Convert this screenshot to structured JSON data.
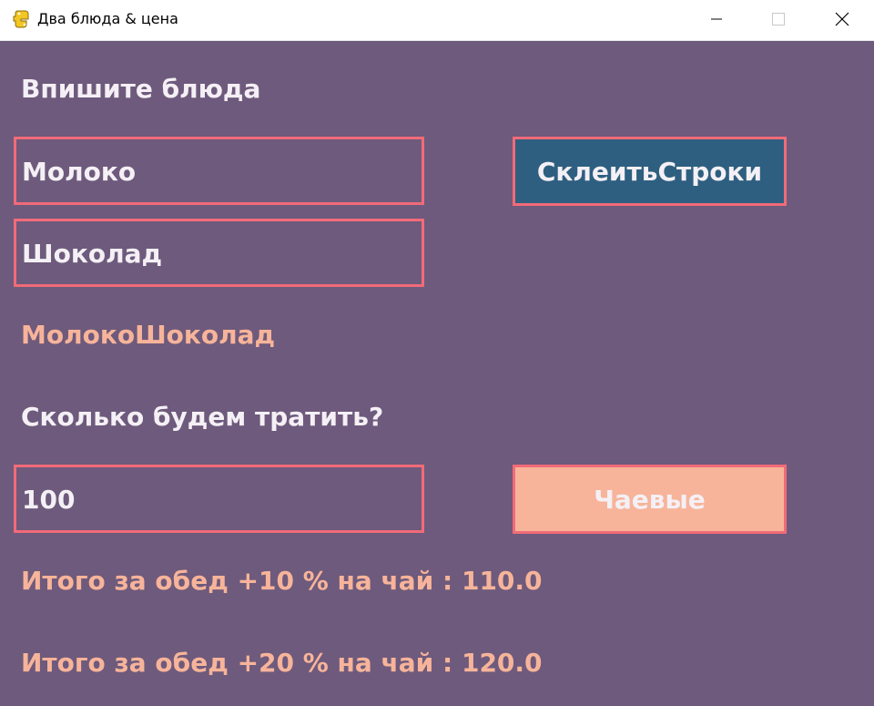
{
  "window": {
    "title": "Два блюда & цена",
    "icon": "python-icon"
  },
  "dishes": {
    "heading": "Впишите блюда",
    "dish1_value": "Молоко",
    "dish2_value": "Шоколад",
    "concat_button_label": "СклеитьСтроки",
    "concat_result": "МолокоШоколад"
  },
  "budget": {
    "heading": "Сколько будем тратить?",
    "amount_value": "100",
    "tips_button_label": "Чаевые",
    "result_10": "Итого за обед +10 % на чай : 110.0",
    "result_20": "Итого за обед +20 % на чай : 120.0"
  },
  "colors": {
    "background": "#6e5a7c",
    "field_border": "#f16b78",
    "concat_button": "#2e5f80",
    "tips_button": "#f7b49a",
    "result_text": "#f7b49a",
    "label_text": "#f4f0f5"
  }
}
